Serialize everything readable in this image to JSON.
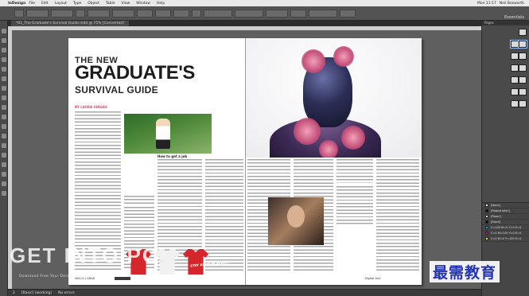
{
  "menubar": {
    "app_name": "InDesign",
    "items": [
      "File",
      "Edit",
      "Layout",
      "Type",
      "Object",
      "Table",
      "View",
      "Window",
      "Help"
    ],
    "right_status": "Mon 11:17",
    "user": "Neil Bosworth"
  },
  "controlbar": {
    "workspace": "Essentials"
  },
  "document": {
    "tab_title": "*01_The Graduate's Survival Guide.indd @ 75% [Converted]"
  },
  "article": {
    "kicker": "THE NEW",
    "headline": "GRADUATE'S",
    "subhead": "SURVIVAL GUIDE",
    "byline": "BY LAURA GINGAS",
    "pull_heading": "How to get a job",
    "shirt_text": "STAY ALIVE IN AFRICA",
    "footer_left": "SKILLS | GRAD",
    "footer_right": "Digital Arts"
  },
  "watermark": {
    "main": "GET INTO PC",
    "dot": ".",
    "sub": "Download Free Your Desired App"
  },
  "status": {
    "page": "2",
    "style": "[Basic] (working)",
    "errors": "No errors"
  },
  "panels": {
    "tab_label": "Pages",
    "page_numbers": [
      "1",
      "2-3",
      "4-5",
      "6-7",
      "8-9",
      "10-11",
      "12-13"
    ],
    "swatches": [
      "[None]",
      "[Registration]",
      "[Paper]",
      "[Black]",
      "C=100 M=0 Y=0 K=0",
      "C=0 M=100 Y=0 K=0",
      "C=0 M=0 Y=100 K=0"
    ]
  },
  "overlay_logo": "最需教育",
  "colors": {
    "accent_pink": "#e14b6e",
    "logo_blue": "#2233b5"
  }
}
